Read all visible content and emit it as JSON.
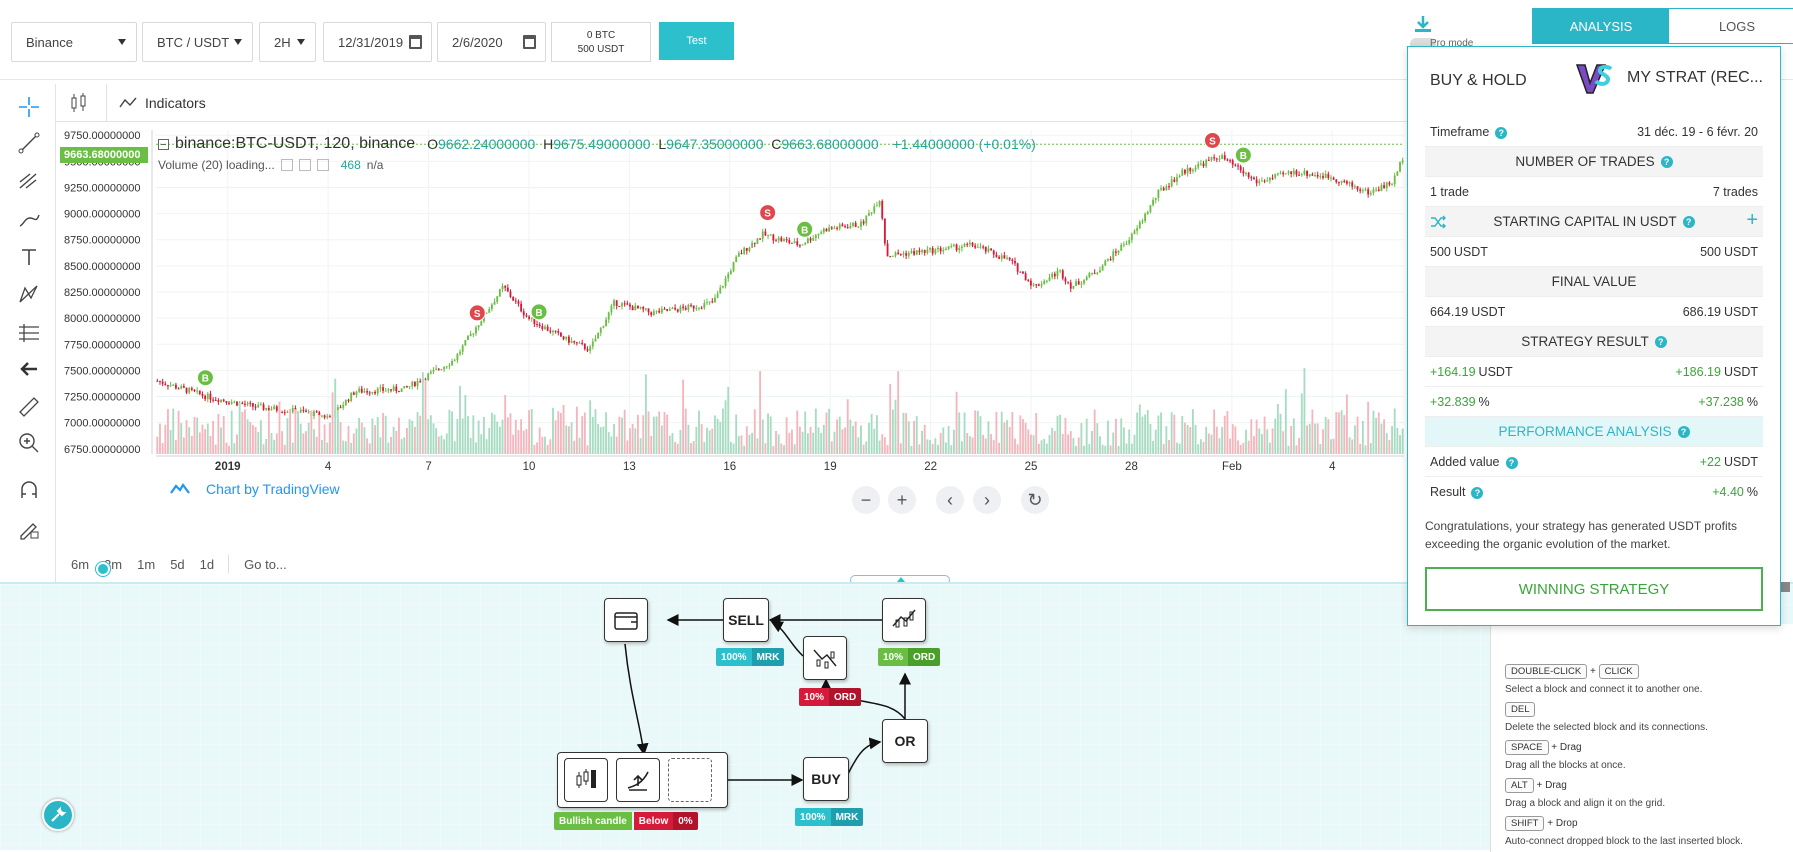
{
  "toolbar": {
    "exchange": "Binance",
    "pair": "BTC / USDT",
    "timeframe": "2H",
    "start_date": "12/31/2019",
    "end_date": "2/6/2020",
    "balance_btc": "0 BTC",
    "balance_usdt": "500 USDT",
    "test_label": "Test",
    "pro_mode_label": "Pro mode"
  },
  "tabs": [
    {
      "label": "ANALYSIS",
      "active": true
    },
    {
      "label": "LOGS",
      "active": false
    }
  ],
  "chart_header": {
    "indicators_label": "Indicators"
  },
  "chart": {
    "symbol": "binance:BTC-USDT, 120, binance",
    "open_label": "O",
    "open": "9662.24000000",
    "high_label": "H",
    "high": "9675.49000000",
    "low_label": "L",
    "low": "9647.35000000",
    "close_label": "C",
    "close": "9663.68000000",
    "change": "+1.44000000 (+0.01%)",
    "volume_label": "Volume (20) loading...",
    "volume_value": "468",
    "volume_na": "n/a",
    "current_price": "9663.68000000",
    "attribution": "Chart by TradingView",
    "colors": {
      "up": "#6abe43",
      "down": "#d41c3a",
      "vol_up": "#a8dcc2",
      "vol_down": "#f4b6bd",
      "grid": "#f0f3f5"
    }
  },
  "chart_data": {
    "type": "candlestick",
    "ylim": [
      6700,
      9800
    ],
    "y_ticks": [
      "9750.00000000",
      "9500.00000000",
      "9250.00000000",
      "9000.00000000",
      "8750.00000000",
      "8500.00000000",
      "8250.00000000",
      "8000.00000000",
      "7750.00000000",
      "7500.00000000",
      "7250.00000000",
      "7000.00000000",
      "6750.00000000"
    ],
    "x_ticks": [
      "2019",
      "4",
      "7",
      "10",
      "13",
      "16",
      "19",
      "22",
      "25",
      "28",
      "Feb",
      "4"
    ],
    "series": [
      {
        "points": [
          [
            0,
            7400
          ],
          [
            4,
            7250
          ],
          [
            8,
            7150
          ],
          [
            12,
            7100
          ],
          [
            14,
            7050
          ],
          [
            16,
            7300
          ],
          [
            20,
            7320
          ],
          [
            24,
            7600
          ],
          [
            26,
            7950
          ],
          [
            28,
            8300
          ],
          [
            30,
            8000
          ],
          [
            33,
            7800
          ],
          [
            35,
            7700
          ],
          [
            37,
            8150
          ],
          [
            40,
            8050
          ],
          [
            43,
            8100
          ],
          [
            45,
            8150
          ],
          [
            47,
            8600
          ],
          [
            49,
            8800
          ],
          [
            52,
            8700
          ],
          [
            54,
            8850
          ],
          [
            57,
            8900
          ],
          [
            58.5,
            9150
          ],
          [
            59,
            8600
          ],
          [
            63,
            8650
          ],
          [
            66,
            8700
          ],
          [
            69,
            8550
          ],
          [
            71,
            8300
          ],
          [
            73,
            8450
          ],
          [
            74,
            8300
          ],
          [
            76,
            8450
          ],
          [
            79,
            8800
          ],
          [
            81,
            9200
          ],
          [
            83,
            9400
          ],
          [
            86,
            9550
          ],
          [
            89,
            9300
          ],
          [
            92,
            9400
          ],
          [
            95,
            9350
          ],
          [
            98,
            9200
          ],
          [
            100,
            9300
          ],
          [
            101,
            9600
          ]
        ]
      }
    ],
    "markers": [
      {
        "type": "B",
        "x": 4,
        "y": 7430
      },
      {
        "type": "S",
        "x": 26,
        "y": 8050
      },
      {
        "type": "B",
        "x": 31,
        "y": 8060
      },
      {
        "type": "S",
        "x": 49.5,
        "y": 9010
      },
      {
        "type": "B",
        "x": 52.5,
        "y": 8850
      },
      {
        "type": "S",
        "x": 85.5,
        "y": 9700
      },
      {
        "type": "B",
        "x": 88,
        "y": 9560
      }
    ],
    "x_range": [
      0,
      101
    ]
  },
  "range_bar": {
    "items": [
      "6m",
      "3m",
      "1m",
      "5d",
      "1d"
    ],
    "goto": "Go to..."
  },
  "analysis": {
    "left_name": "BUY & HOLD",
    "right_name": "MY STRAT (REC...",
    "timeframe_label": "Timeframe",
    "timeframe_value": "31 déc. 19 - 6 févr. 20",
    "trades_title": "NUMBER OF TRADES",
    "trades_left": "1 trade",
    "trades_right": "7 trades",
    "capital_title": "STARTING CAPITAL IN USDT",
    "capital_left": "500",
    "capital_right": "500",
    "final_title": "FINAL VALUE",
    "final_left": "664.19",
    "final_right": "686.19",
    "result_title": "STRATEGY RESULT",
    "result_left": "+164.19",
    "result_right": "+186.19",
    "pct_left": "+32.839",
    "pct_right": "+37.238",
    "pct_unit": "%",
    "usdt_unit": "USDT",
    "perf_title": "PERFORMANCE ANALYSIS",
    "added_label": "Added value",
    "added_value": "+22",
    "res_label": "Result",
    "res_value": "+4.40",
    "congrats": "Congratulations, your strategy has generated USDT profits exceeding the organic evolution of the market.",
    "winning": "WINNING STRATEGY"
  },
  "flow": {
    "sell": "SELL",
    "buy": "BUY",
    "or": "OR",
    "sell_pct": "100%",
    "sell_type": "MRK",
    "buy_pct": "100%",
    "buy_type": "MRK",
    "down_pct": "10%",
    "down_type": "ORD",
    "up_pct": "10%",
    "up_type": "ORD",
    "cond1": "Bullish candle",
    "cond2_a": "Below",
    "cond2_b": "0%"
  },
  "help": {
    "items": [
      {
        "keys": [
          "DOUBLE-CLICK",
          "CLICK"
        ],
        "joiner": "+",
        "desc": "Select a block and connect it to another one."
      },
      {
        "keys": [
          "DEL"
        ],
        "joiner": "",
        "desc": "Delete the selected block and its connections."
      },
      {
        "keys": [
          "SPACE"
        ],
        "joiner": "+ Drag",
        "desc": "Drag all the blocks at once."
      },
      {
        "keys": [
          "ALT"
        ],
        "joiner": "+ Drag",
        "desc": "Drag a block and align it on the grid."
      },
      {
        "keys": [
          "SHIFT"
        ],
        "joiner": "+ Drop",
        "desc": "Auto-connect dropped block to the last inserted block."
      }
    ]
  }
}
